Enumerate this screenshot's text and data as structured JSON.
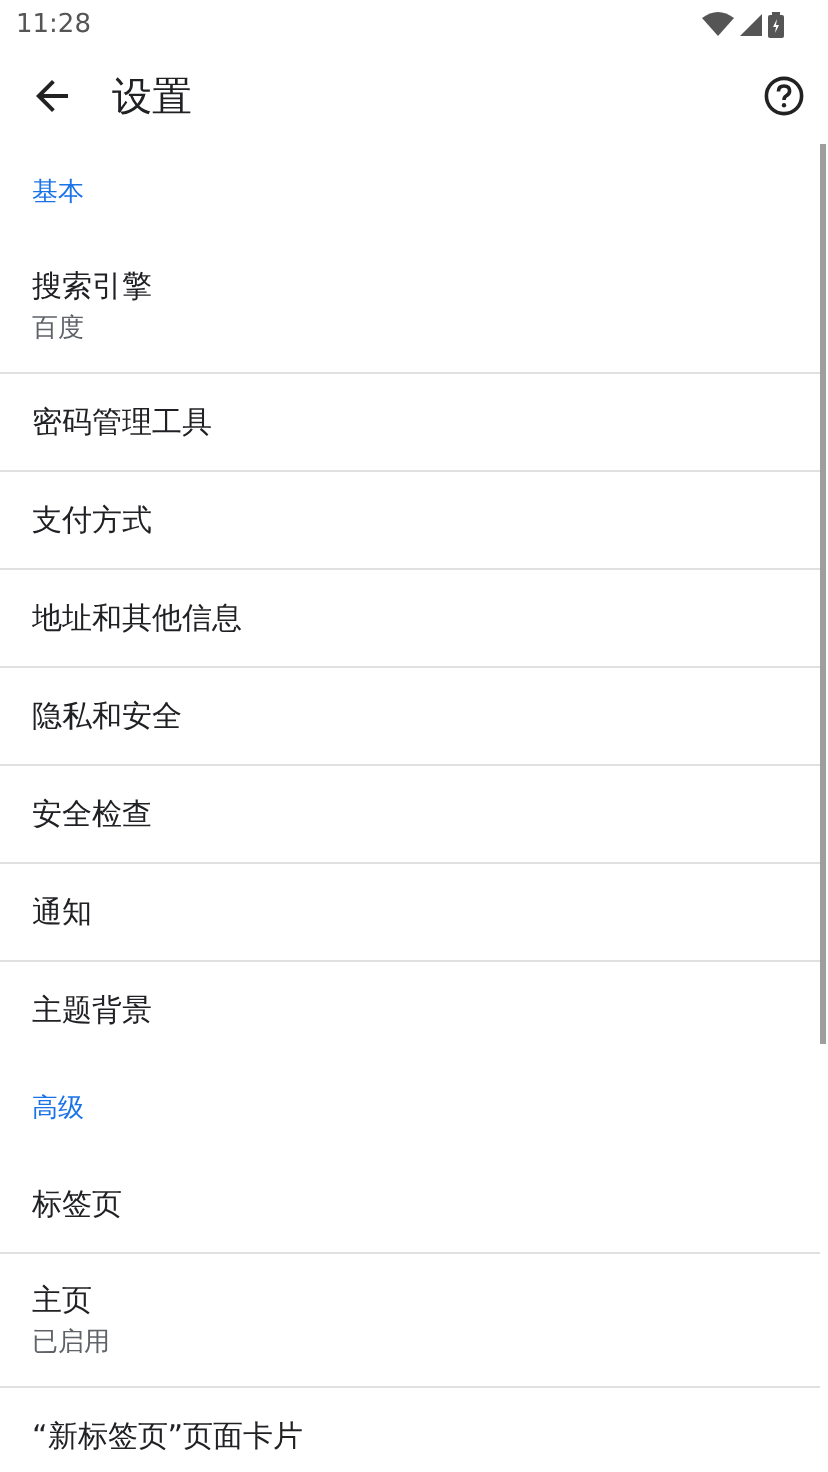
{
  "status_bar": {
    "time": "11:28"
  },
  "app_bar": {
    "title": "设置"
  },
  "sections": [
    {
      "title": "基本",
      "items": [
        {
          "title": "搜索引擎",
          "subtitle": "百度"
        },
        {
          "title": "密码管理工具"
        },
        {
          "title": "支付方式"
        },
        {
          "title": "地址和其他信息"
        },
        {
          "title": "隐私和安全"
        },
        {
          "title": "安全检查"
        },
        {
          "title": "通知"
        },
        {
          "title": "主题背景"
        }
      ]
    },
    {
      "title": "高级",
      "items": [
        {
          "title": "标签页"
        },
        {
          "title": "主页",
          "subtitle": "已启用"
        },
        {
          "title": "“新标签页”页面卡片"
        }
      ]
    }
  ]
}
